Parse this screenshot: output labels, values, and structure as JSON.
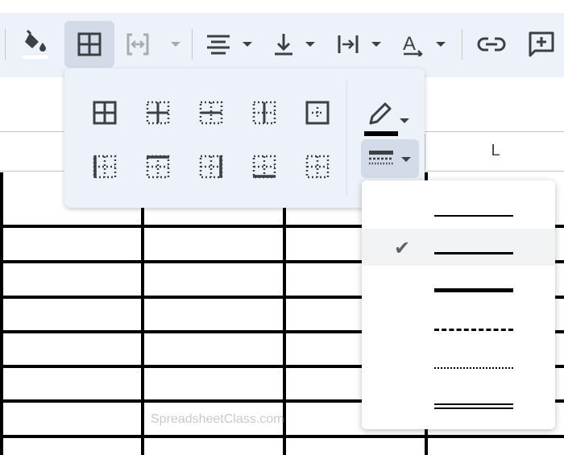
{
  "toolbar": {
    "buttons": [
      {
        "name": "fill-color-button",
        "icon": "paint-bucket-icon"
      },
      {
        "name": "borders-button",
        "icon": "borders-grid-icon",
        "active": true
      },
      {
        "name": "merge-cells-button",
        "icon": "merge-cells-icon",
        "disabled": true
      },
      {
        "name": "horizontal-align-button",
        "icon": "align-center-icon"
      },
      {
        "name": "vertical-align-button",
        "icon": "align-bottom-icon"
      },
      {
        "name": "text-wrapping-button",
        "icon": "text-wrap-icon"
      },
      {
        "name": "text-rotation-button",
        "icon": "text-rotation-icon"
      },
      {
        "name": "insert-link-button",
        "icon": "link-icon"
      },
      {
        "name": "insert-comment-button",
        "icon": "add-comment-icon"
      }
    ],
    "fill_color": "#ffffff"
  },
  "border_panel": {
    "options": [
      "all-borders",
      "inner-borders",
      "horizontal-borders",
      "vertical-borders",
      "outer-borders",
      "left-border",
      "top-border",
      "right-border",
      "bottom-border",
      "clear-borders"
    ],
    "border_color": "#000000",
    "color_icon": "pencil-icon",
    "style_icon": "border-style-icon"
  },
  "border_style_menu": {
    "styles": [
      "thin-solid",
      "medium-solid",
      "thick-solid",
      "dashed",
      "dotted",
      "double"
    ],
    "selected": "medium-solid",
    "check_glyph": "✔"
  },
  "sheet": {
    "column_label": "L"
  },
  "watermark": "SpreadsheetClass.com"
}
